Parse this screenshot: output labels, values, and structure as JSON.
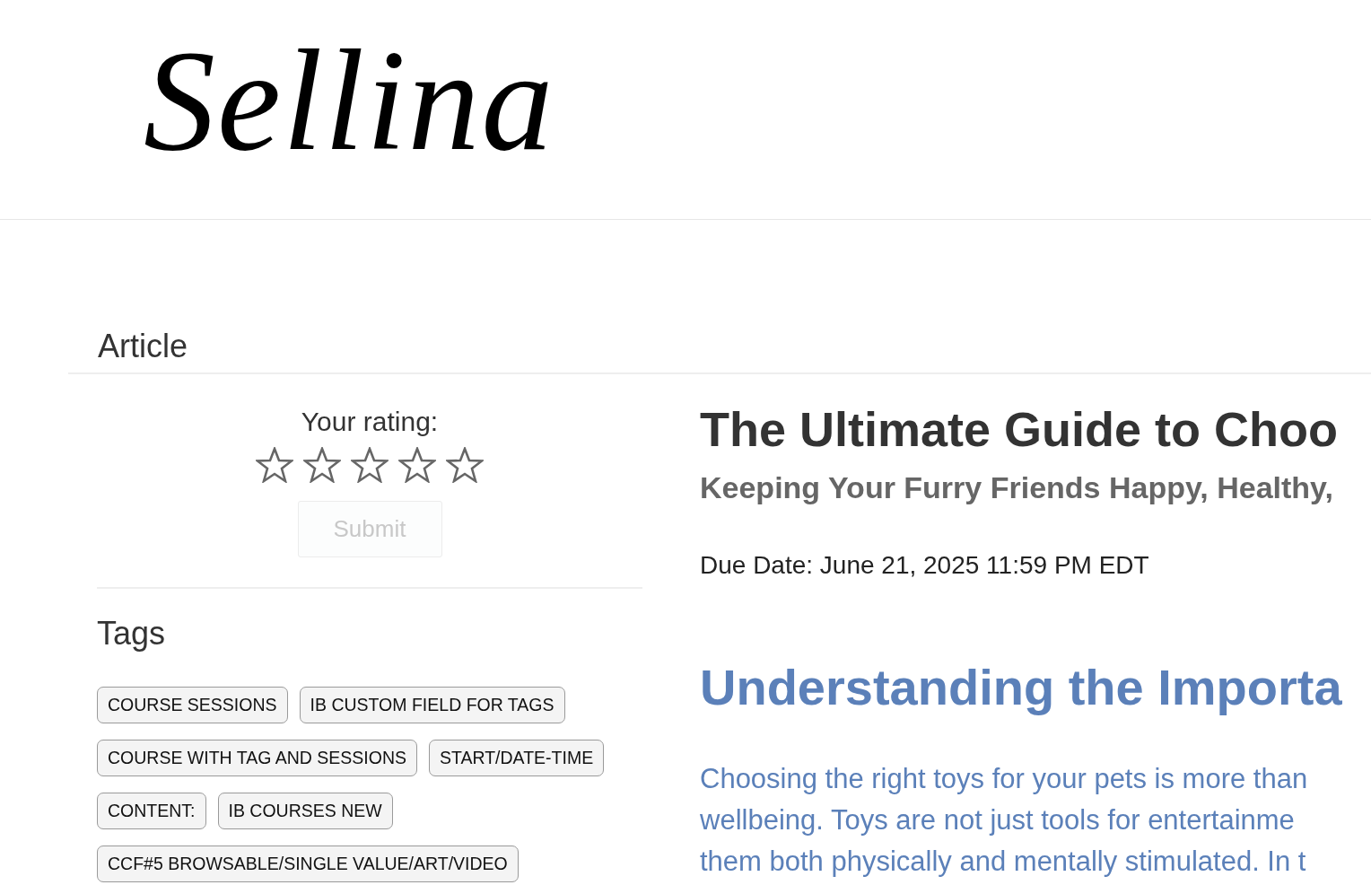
{
  "header": {
    "logo": "Sellina"
  },
  "section_title": "Article",
  "rating": {
    "label": "Your rating:",
    "stars": 0,
    "submit": {
      "label": "Submit",
      "disabled": true
    }
  },
  "tags": {
    "title": "Tags",
    "items": [
      "COURSE SESSIONS",
      "IB CUSTOM FIELD FOR TAGS",
      "COURSE WITH TAG AND SESSIONS",
      "START/DATE-TIME",
      "CONTENT:",
      "IB COURSES NEW",
      "CCF#5 BROWSABLE/SINGLE VALUE/ART/VIDEO"
    ]
  },
  "article": {
    "title": "The Ultimate Guide to Choo",
    "subtitle": "Keeping Your Furry Friends Happy, Healthy,",
    "due_date": "Due Date: June 21, 2025 11:59 PM EDT",
    "heading": "Understanding the Importa",
    "paragraph_lines": [
      "Choosing the right toys for your pets is more than",
      "wellbeing. Toys are not just tools for entertainme",
      "them both physically and mentally stimulated. In t"
    ]
  }
}
